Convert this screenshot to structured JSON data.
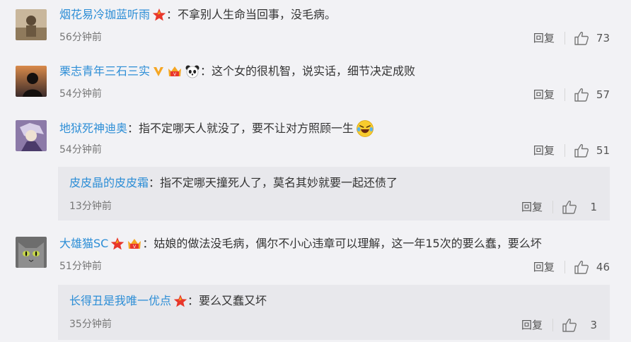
{
  "comments": [
    {
      "username": "烟花易冷珈蓝听雨",
      "text": "：不拿别人生命当回事，没毛病。",
      "time": "56分钟前",
      "reply": "回复",
      "likes": "73"
    },
    {
      "username": "栗志青年三石三实",
      "text": "：这个女的很机智，说实话，细节决定成败",
      "time": "54分钟前",
      "reply": "回复",
      "likes": "57"
    },
    {
      "username": "地狱死神迪奥",
      "text": "：指不定哪天人就没了，要不让对方照顾一生",
      "time": "54分钟前",
      "reply": "回复",
      "likes": "51"
    },
    {
      "username": "皮皮晶的皮皮霜",
      "text": "：指不定哪天撞死人了，莫名其妙就要一起还债了",
      "time": "13分钟前",
      "reply": "回复",
      "likes": "1"
    },
    {
      "username": "大雄猫SC",
      "text": "：姑娘的做法没毛病，偶尔不小心违章可以理解，这一年15次的要么蠢，要么坏",
      "time": "51分钟前",
      "reply": "回复",
      "likes": "46"
    },
    {
      "username": "长得丑是我唯一优点",
      "text": "：要么又蠢又坏",
      "time": "35分钟前",
      "reply": "回复",
      "likes": "3"
    }
  ],
  "icons": {
    "star_badge": "red-star-badge",
    "v_badge": "orange-v-verified-badge",
    "vip_badge": "crown-vip-badge",
    "panda_badge": "panda-badge",
    "emoji": "laugh-cry-emoji",
    "like": "thumbs-up-icon"
  },
  "colors": {
    "username": "#2d8ed6",
    "text": "#333333",
    "time": "#777777",
    "star": "#e8362b",
    "v_badge": "#f5a623",
    "background": "#f2f2f5",
    "nested_background": "#e8e8ec"
  }
}
